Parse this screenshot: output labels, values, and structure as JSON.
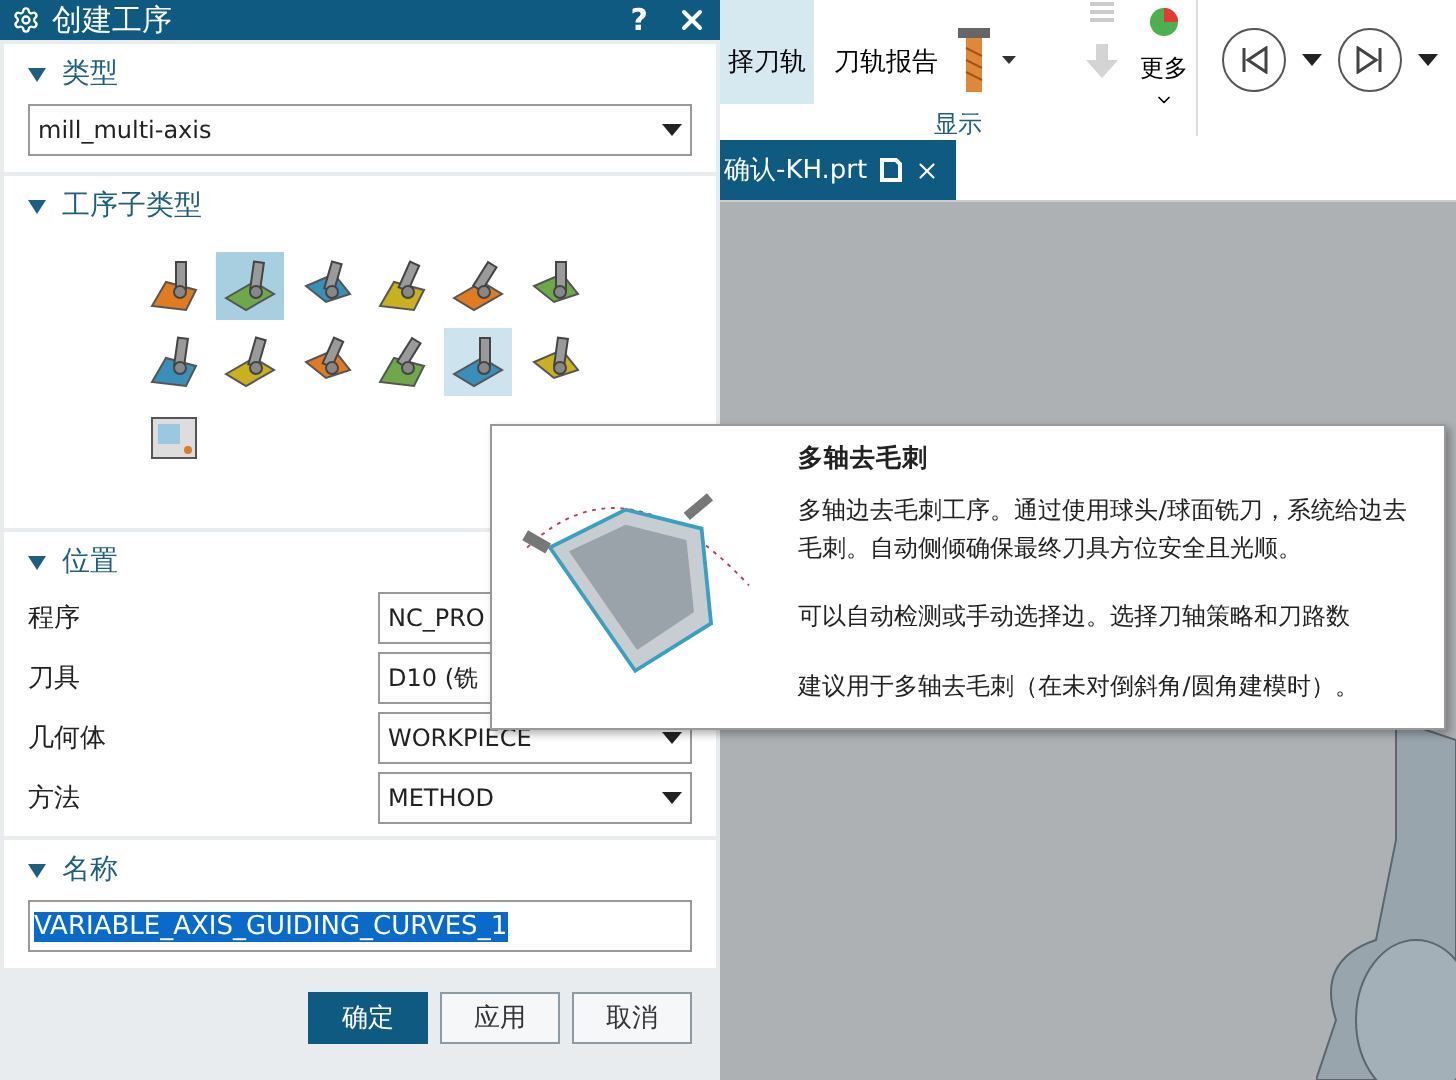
{
  "dialog": {
    "title": "创建工序",
    "help": "?"
  },
  "type_section": {
    "heading": "类型",
    "expanded": true,
    "value": "mill_multi-axis"
  },
  "subtype_section": {
    "heading": "工序子类型",
    "expanded": true,
    "items": [
      {
        "selected": false,
        "hovered": false
      },
      {
        "selected": true,
        "hovered": false
      },
      {
        "selected": false,
        "hovered": false
      },
      {
        "selected": false,
        "hovered": false
      },
      {
        "selected": false,
        "hovered": false
      },
      {
        "selected": false,
        "hovered": false
      },
      {
        "selected": false,
        "hovered": false
      },
      {
        "selected": false,
        "hovered": false
      },
      {
        "selected": false,
        "hovered": false
      },
      {
        "selected": false,
        "hovered": false
      },
      {
        "selected": false,
        "hovered": true
      },
      {
        "selected": false,
        "hovered": false
      },
      {
        "selected": false,
        "hovered": false
      }
    ]
  },
  "location_section": {
    "heading": "位置",
    "expanded": true,
    "fields": [
      {
        "label": "程序",
        "value": "NC_PRO"
      },
      {
        "label": "刀具",
        "value": "D10 (铣"
      },
      {
        "label": "几何体",
        "value": "WORKPIECE"
      },
      {
        "label": "方法",
        "value": "METHOD"
      }
    ]
  },
  "name_section": {
    "heading": "名称",
    "expanded": true,
    "value": "VARIABLE_AXIS_GUIDING_CURVES_1",
    "text_selected": true
  },
  "buttons": [
    {
      "label": "确定",
      "kind": "primary"
    },
    {
      "label": "应用",
      "kind": "normal"
    },
    {
      "label": "取消",
      "kind": "normal"
    }
  ],
  "ribbon": {
    "buttons": [
      {
        "label": "择刀轨",
        "selected": true
      },
      {
        "label": "刀轨报告",
        "selected": false
      }
    ],
    "more": "更多",
    "group_label": "显示"
  },
  "document_tab": {
    "label": "确认-KH.prt",
    "selected": true
  },
  "tooltip": {
    "title": "多轴去毛刺",
    "paragraphs": [
      "多轴边去毛刺工序。通过使用球头/球面铣刀，系统给边去毛刺。自动侧倾确保最终刀具方位安全且光顺。",
      "可以自动检测或手动选择边。选择刀轴策略和刀路数",
      "建议用于多轴去毛刺（在未对倒斜角/圆角建模时）。"
    ]
  }
}
